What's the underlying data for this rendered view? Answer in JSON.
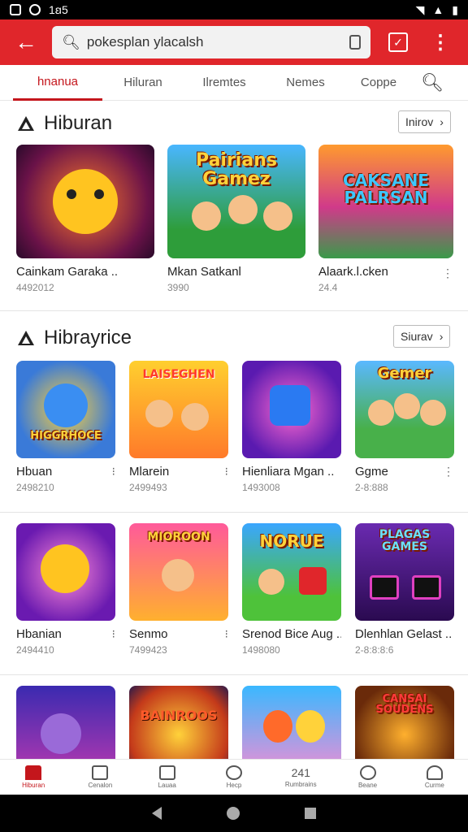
{
  "status": {
    "time": "1ꞛ5"
  },
  "search": {
    "value": "pokesplan ylacalsh"
  },
  "tabs": [
    {
      "label": "hnanua"
    },
    {
      "label": "Hiluran"
    },
    {
      "label": "Ilremtes"
    },
    {
      "label": "Nemes"
    },
    {
      "label": "Coppe"
    }
  ],
  "sections": [
    {
      "title": "Hiburan",
      "more": "Inirov",
      "cards": [
        {
          "title": "Cainkam Garaka ..",
          "meta": "4492012",
          "art": ""
        },
        {
          "title": "Mkan Satkanl",
          "meta": "3990",
          "art": "Pairians Gamez"
        },
        {
          "title": "Alaark.l.cken",
          "meta": "24.4",
          "art": "CAKSANE PALRSAN"
        }
      ]
    },
    {
      "title": "Hibrayrice",
      "more": "Siurav",
      "cards": [
        {
          "title": "Hbuan",
          "meta": "2498210",
          "art": "HIGGRHOCE"
        },
        {
          "title": "Mlarein",
          "meta": "2499493",
          "art": "LAISEGHEN"
        },
        {
          "title": "Hienliara Mgan ..",
          "meta": "1493008",
          "art": ""
        },
        {
          "title": "Ggme",
          "meta": "2-8:888",
          "art": "Gemer"
        },
        {
          "title": "Hbanian",
          "meta": "2494410",
          "art": ""
        },
        {
          "title": "Senmo",
          "meta": "7499423",
          "art": "MIOROON"
        },
        {
          "title": "Srenod Bice Aug ..",
          "meta": "1498080",
          "art": "NORUE"
        },
        {
          "title": "Dlenhlan Gelast ..",
          "meta": "2-8:8:8:6",
          "art": "PLAGAS GAMES"
        },
        {
          "title": "",
          "meta": "",
          "art": ""
        },
        {
          "title": "",
          "meta": "",
          "art": "BAINROOS"
        },
        {
          "title": "",
          "meta": "",
          "art": ""
        },
        {
          "title": "",
          "meta": "",
          "art": "CANSAI SOUDENS"
        }
      ]
    }
  ],
  "bottom_nav": [
    {
      "label": "Hiburan"
    },
    {
      "label": "Cenalon"
    },
    {
      "label": "Lauaa"
    },
    {
      "label": "Hecp"
    },
    {
      "label": "Rumbrains",
      "badge": "241"
    },
    {
      "label": "Beane"
    },
    {
      "label": "Curme"
    }
  ]
}
